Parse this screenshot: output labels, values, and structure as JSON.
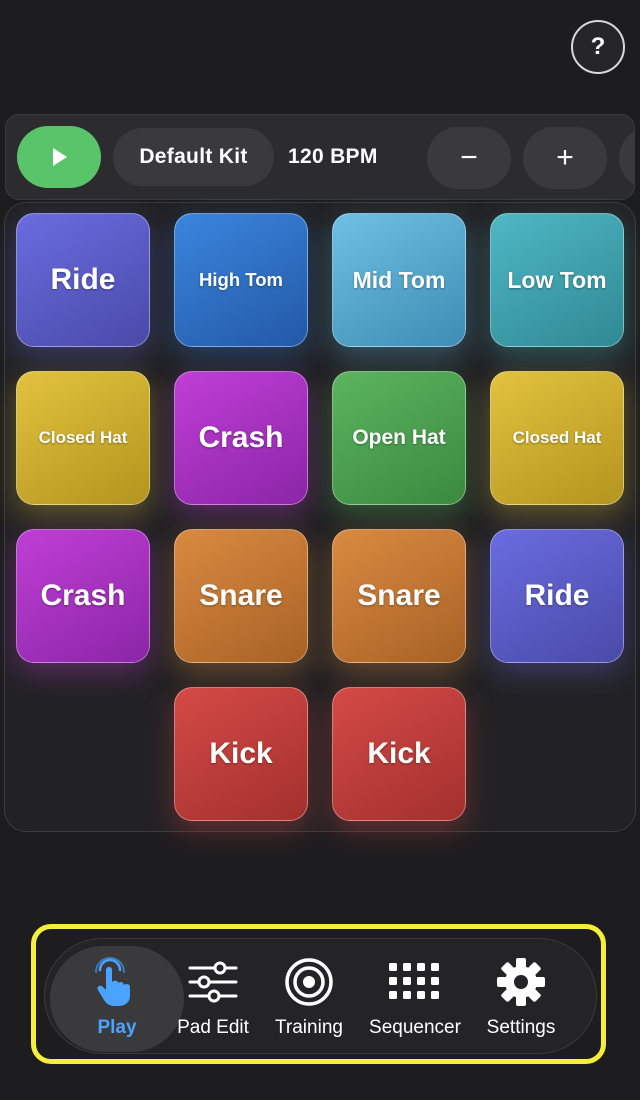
{
  "header": {
    "help_label": "?"
  },
  "toolbar": {
    "kit_label": "Default Kit",
    "bpm_label": "120 BPM",
    "decrease_label": "−",
    "increase_label": "+"
  },
  "pads": [
    {
      "label": "Ride",
      "color": "#5f5fcf"
    },
    {
      "label": "High Tom",
      "color": "#2f6fc6"
    },
    {
      "label": "Mid Tom",
      "color": "#56a8cf"
    },
    {
      "label": "Low Tom",
      "color": "#3fa1ad"
    },
    {
      "label": "Closed Hat",
      "color": "#cdae30"
    },
    {
      "label": "Crash",
      "color": "#a532bf"
    },
    {
      "label": "Open Hat",
      "color": "#4b9f4f"
    },
    {
      "label": "Closed Hat",
      "color": "#cdae30"
    },
    {
      "label": "Crash",
      "color": "#a532bf"
    },
    {
      "label": "Snare",
      "color": "#c27634"
    },
    {
      "label": "Snare",
      "color": "#c27634"
    },
    {
      "label": "Ride",
      "color": "#5f5fcf"
    },
    {
      "label": "Kick",
      "color": "#bf3d3a"
    },
    {
      "label": "Kick",
      "color": "#bf3d3a"
    }
  ],
  "nav": {
    "items": [
      {
        "label": "Play",
        "icon": "tap-hand-icon",
        "active": true
      },
      {
        "label": "Pad Edit",
        "icon": "sliders-icon",
        "active": false
      },
      {
        "label": "Training",
        "icon": "target-icon",
        "active": false
      },
      {
        "label": "Sequencer",
        "icon": "grid-icon",
        "active": false
      },
      {
        "label": "Settings",
        "icon": "gear-icon",
        "active": false
      }
    ],
    "active_color": "#4aa3ff",
    "highlight_color": "#f6ee3c"
  }
}
